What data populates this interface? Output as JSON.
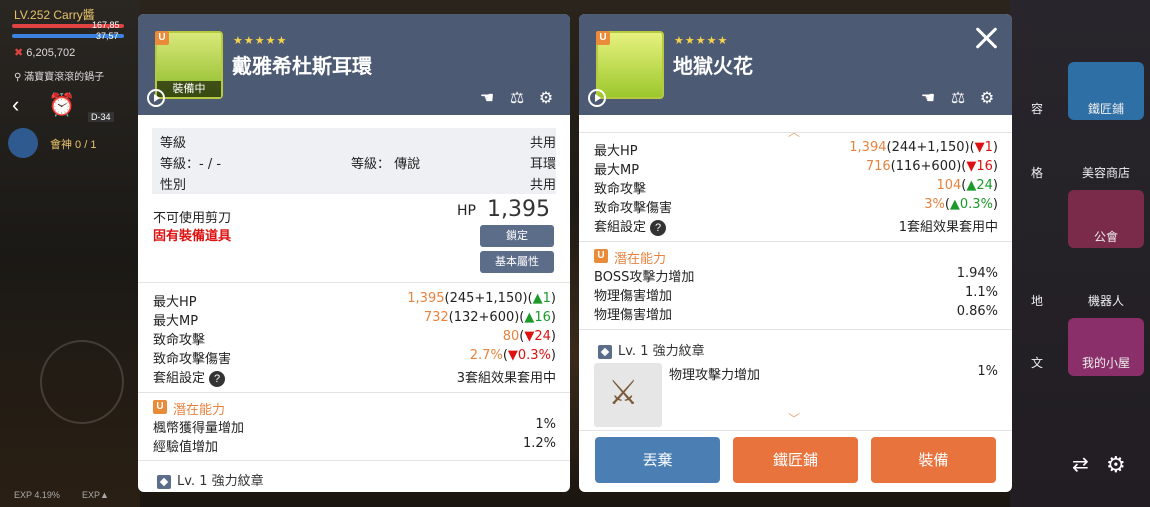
{
  "hud": {
    "level_name": "LV.252 Carry醬",
    "hp_text": "167,85",
    "mp_text": "37,57",
    "meso": "6,205,702",
    "location": "滿寶寶滾滾的鍋子",
    "exp_left": "EXP 4.19%",
    "exp_right": "EXP▲",
    "stage": "D-34",
    "guild": "會神 0 / 1"
  },
  "right_menu": {
    "items": [
      "鐵匠鋪",
      "美容商店",
      "公會",
      "機器人",
      "我的小屋"
    ],
    "partial": [
      "容",
      "格",
      "地",
      "文"
    ]
  },
  "left_panel": {
    "badge": "U",
    "stars": "★★★★★",
    "title": "戴雅希杜斯耳環",
    "equipped": "裝備中",
    "info_rows": [
      {
        "left": "等級",
        "mid": "",
        "right": "共用"
      },
      {
        "left": "等級：- / -",
        "mid": "等級： 傳說",
        "right": "耳環"
      },
      {
        "left": "性別",
        "mid": "",
        "right": "共用"
      }
    ],
    "no_scissors": "不可使用剪刀",
    "unique_item": "固有裝備道具",
    "hp_label": "HP",
    "hp_value": "1,395",
    "lock_btn": "鎖定",
    "base_attr_btn": "基本屬性",
    "stats": [
      {
        "name": "最大HP",
        "main": "1,395",
        "rest": "(245+1,150)(",
        "arrow": "▲",
        "delta": "1",
        "dir": "up",
        "end": ")"
      },
      {
        "name": "最大MP",
        "main": "732",
        "rest": "(132+600)(",
        "arrow": "▲",
        "delta": "16",
        "dir": "up",
        "end": ")"
      },
      {
        "name": "致命攻擊",
        "main": "80",
        "rest": "(",
        "arrow": "▼",
        "delta": "24",
        "dir": "down",
        "end": ")"
      },
      {
        "name": "致命攻擊傷害",
        "main": "2.7%",
        "rest": "(",
        "arrow": "▼",
        "delta": "0.3%",
        "dir": "down",
        "end": ")"
      }
    ],
    "set_label": "套組設定",
    "set_value": "3套組效果套用中",
    "potential_label": "潛在能力",
    "potentials": [
      {
        "name": "楓幣獲得量增加",
        "value": "1%"
      },
      {
        "name": "經驗值增加",
        "value": "1.2%"
      }
    ],
    "emblem": "Lv. 1 強力紋章"
  },
  "right_panel": {
    "badge": "U",
    "stars": "★★★★★",
    "title": "地獄火花",
    "stats": [
      {
        "name": "最大HP",
        "main": "1,394",
        "rest": "(244+1,150)(",
        "arrow": "▼",
        "delta": "1",
        "dir": "down",
        "end": ")"
      },
      {
        "name": "最大MP",
        "main": "716",
        "rest": "(116+600)(",
        "arrow": "▼",
        "delta": "16",
        "dir": "down",
        "end": ")"
      },
      {
        "name": "致命攻擊",
        "main": "104",
        "rest": "(",
        "arrow": "▲",
        "delta": "24",
        "dir": "up",
        "end": ")"
      },
      {
        "name": "致命攻擊傷害",
        "main": "3%",
        "rest": "(",
        "arrow": "▲",
        "delta": "0.3%",
        "dir": "up",
        "end": ")"
      }
    ],
    "set_label": "套組設定",
    "set_value": "1套組效果套用中",
    "potential_label": "潛在能力",
    "potentials": [
      {
        "name": "BOSS攻擊力增加",
        "value": "1.94%"
      },
      {
        "name": "物理傷害增加",
        "value": "1.1%"
      },
      {
        "name": "物理傷害增加",
        "value": "0.86%"
      }
    ],
    "emblem": "Lv. 1 強力紋章",
    "emblem_stat": {
      "name": "物理攻擊力增加",
      "value": "1%"
    },
    "buttons": {
      "discard": "丟棄",
      "blacksmith": "鐵匠鋪",
      "equip": "裝備"
    }
  },
  "colors": {
    "header": "#4c5a73",
    "accent": "#e8833f",
    "discard": "#4b7fb4",
    "action": "#e8733d"
  }
}
